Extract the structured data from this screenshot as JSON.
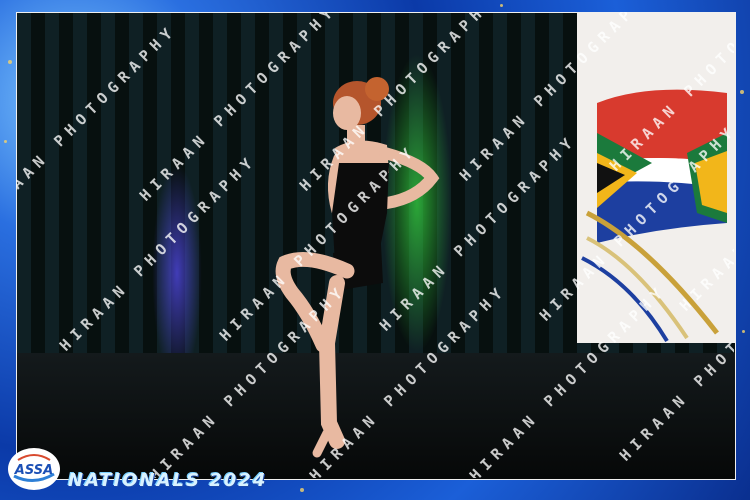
{
  "event": {
    "logo_text": "ASSA",
    "title": "NATIONALS 2024"
  },
  "watermark": {
    "text": "HIRAAN PHOTOGRAPHY"
  },
  "colors": {
    "frame_blue": "#0b3aa8",
    "sparkle_gold": "#f5d36a",
    "stage_green_light": "#32c83c",
    "stage_blue_light": "#5a50ff"
  },
  "icons": {
    "logo": "assa-logo-icon",
    "flag": "south-africa-flag-icon"
  }
}
